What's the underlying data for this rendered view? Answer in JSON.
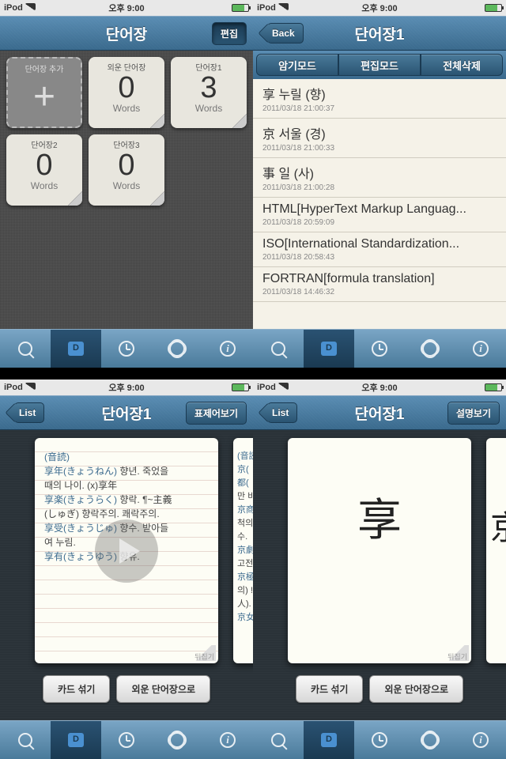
{
  "status": {
    "device": "iPod",
    "time": "오후 9:00"
  },
  "screen1": {
    "title": "단어장",
    "edit_btn": "편집",
    "cards": {
      "add": "단어장 추가",
      "unit": "Words",
      "items": [
        {
          "name": "외운 단어장",
          "count": "0"
        },
        {
          "name": "단어장1",
          "count": "3"
        },
        {
          "name": "단어장2",
          "count": "0"
        },
        {
          "name": "단어장3",
          "count": "0"
        }
      ]
    }
  },
  "screen2": {
    "back": "Back",
    "title": "단어장1",
    "segs": [
      "암기모드",
      "편집모드",
      "전체삭제"
    ],
    "items": [
      {
        "t": "享 누릴 (향)",
        "d": "2011/03/18 21:00:37"
      },
      {
        "t": "京 서울 (경)",
        "d": "2011/03/18 21:00:33"
      },
      {
        "t": "事 일 (사)",
        "d": "2011/03/18 21:00:28"
      },
      {
        "t": "HTML[HyperText Markup Languag...",
        "d": "2011/03/18 20:59:09"
      },
      {
        "t": "ISO[International Standardization...",
        "d": "2011/03/18 20:58:43"
      },
      {
        "t": "FORTRAN[formula translation]",
        "d": "2011/03/18 14:46:32"
      }
    ]
  },
  "screen3": {
    "list_btn": "List",
    "title": "단어장1",
    "right_btn": "표제어보기",
    "header": "(音読)",
    "lines": [
      {
        "l": "享年(きょうねん)",
        "t": " 향년. 죽었을"
      },
      {
        "l": "",
        "t": "때의 나이. (x)享年"
      },
      {
        "l": "享楽(きょうらく)",
        "t": " 향락. ¶~主義"
      },
      {
        "l": "",
        "t": "(しゅぎ) 향락주의. 쾌락주의."
      },
      {
        "l": "享受(きょうじゅ)",
        "t": " 향수. 받아들"
      },
      {
        "l": "",
        "t": "여 누림."
      },
      {
        "l": "享有(きょうゆう)",
        "t": " 향유."
      }
    ],
    "flip": "뒤집기",
    "btns": [
      "카드 섞기",
      "외운 단어장으로"
    ],
    "peek": [
      "(音読)",
      "京(",
      "都(",
      "만 비",
      "京商",
      "척의",
      "수.",
      "京劇",
      "고전",
      "京極",
      "의) !",
      "人).",
      "京女"
    ]
  },
  "screen4": {
    "list_btn": "List",
    "title": "단어장1",
    "right_btn": "설명보기",
    "char": "享",
    "peek_char": "京",
    "flip": "뒤집기",
    "btns": [
      "카드 섞기",
      "외운 단어장으로"
    ]
  }
}
